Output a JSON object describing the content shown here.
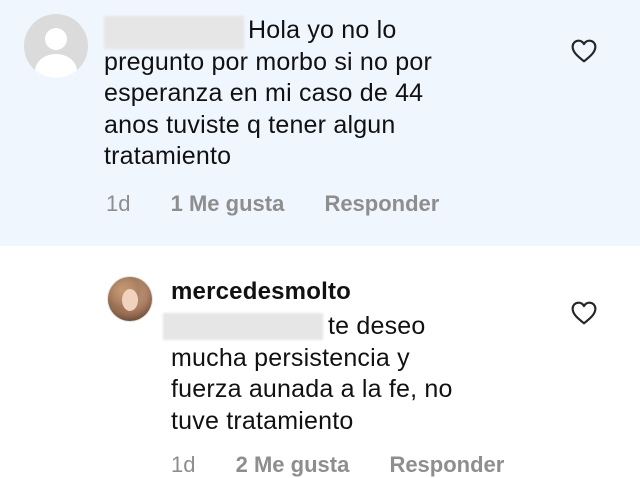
{
  "comments": [
    {
      "username": "",
      "lines": [
        "Hola yo no lo",
        "pregunto por morbo si no por",
        "esperanza en mi caso de 44",
        "anos tuviste q tener algun",
        "tratamiento"
      ],
      "time": "1d",
      "likes": "1 Me gusta",
      "reply": "Responder",
      "avatar": "default-user-avatar"
    },
    {
      "username": "mercedesmolto",
      "lines": [
        "te deseo",
        "mucha persistencia y",
        "fuerza aunada a la fe,  no",
        "tuve tratamiento"
      ],
      "time": "1d",
      "likes": "2 Me gusta",
      "reply": "Responder",
      "avatar": "profile-photo"
    }
  ],
  "colors": {
    "highlight_bg": "#eff6fe",
    "text": "#111111",
    "meta": "#8e8e8e",
    "heart_stroke": "#262626"
  },
  "icons": {
    "like": "heart-outline-icon"
  }
}
